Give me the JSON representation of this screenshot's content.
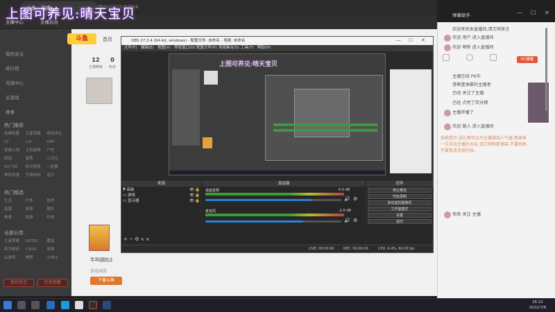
{
  "overlay": {
    "stream_title": "上图可养见:晴天宝贝"
  },
  "browser": {
    "tab_label": "斗鱼 - 直播",
    "url": "7fb5b7d2257b99b8",
    "bookmarks": [
      "主播中心",
      "主播后台"
    ]
  },
  "sidebar": {
    "items": [
      "我的关注",
      "排行榜",
      "充值中心",
      "云游戏",
      "赛事"
    ],
    "section1": "热门推荐",
    "grid1": [
      "英雄联盟",
      "王者荣耀",
      "绝地求生",
      "CF",
      "LOL",
      "DNF",
      "穿越火线",
      "主机游戏",
      "户外",
      "颜值",
      "星秀",
      "二次元",
      "QQ飞车",
      "和平精英",
      "一起看",
      "单机热游",
      "手游休闲",
      "音乐"
    ],
    "section2": "热门精选",
    "grid2": [
      "生活",
      "户外",
      "鱼吧",
      "直播",
      "体育",
      "娱乐",
      "美食",
      "旅游",
      "科技"
    ],
    "section3": "全部分类",
    "grid3": [
      "王者荣耀",
      "DOTA2",
      "魔兽",
      "和平精英",
      "CSGO",
      "原神",
      "云游戏",
      "棋牌",
      "斗地主"
    ],
    "btn_left": "我的关注",
    "btn_right": "历史观看"
  },
  "page": {
    "logo": "斗鱼",
    "tab": "首页",
    "stats": [
      {
        "value": "12",
        "label": "主播等级"
      },
      {
        "value": "0",
        "label": "粉丝"
      },
      {
        "value": "0",
        "label": "关注"
      }
    ],
    "card_title": "牛叫胡比2",
    "card_sub": "游戏画质",
    "download_label": "下载斗鱼"
  },
  "chat": {
    "title": "弹幕助手",
    "pcb_label": "PC弹幕",
    "lines": [
      "欢迎来到本直播间,请文明发言",
      "欢迎 用户 进入直播间",
      "欢迎 萌新 进入直播间",
      "主播在线 PK中",
      "请尊重弹幕的主播者",
      "已经 关注了主播",
      "已经 点亮了荧光棒",
      "主播开播了",
      "欢迎 路人 进入直播间"
    ],
    "gift_text": "系统提示:送礼物可以为主播增加人气值,感谢每一位支持主播的水友,请文明观看弹幕,不要刷屏,不要发送违规内容。",
    "last_line": "快来 关注 主播"
  },
  "obs": {
    "title": "OBS 27.2.4 (64-bit, windows) - 配置文件: 未命名 - 场景: 未命名",
    "menus": [
      "文件(F)",
      "编辑(E)",
      "视图(V)",
      "停靠窗口(D)",
      "配置文件(P)",
      "场景集合(S)",
      "工具(T)",
      "帮助(H)"
    ],
    "scenes_header": "来源",
    "mixer_header": "混音器",
    "controls_header": "控件",
    "sources": [
      "高级",
      "游戏",
      "显示器"
    ],
    "mixer_tracks": [
      {
        "name": "桌面音频",
        "db": "0.0 dB",
        "level": 0.78
      },
      {
        "name": "麦克风",
        "db": "-2.0 dB",
        "level": 0.72
      }
    ],
    "controls": [
      "停止推流",
      "开始录制",
      "启动虚拟摄像机",
      "工作室模式",
      "设置",
      "退出"
    ],
    "status": {
      "live": "LIVE: 00:00:00",
      "rec": "REC: 00:00:00",
      "cpu": "CPU: 0.4%, 60.00 fps"
    }
  },
  "taskbar": {
    "time": "16:22",
    "date": "2022/7/6"
  }
}
